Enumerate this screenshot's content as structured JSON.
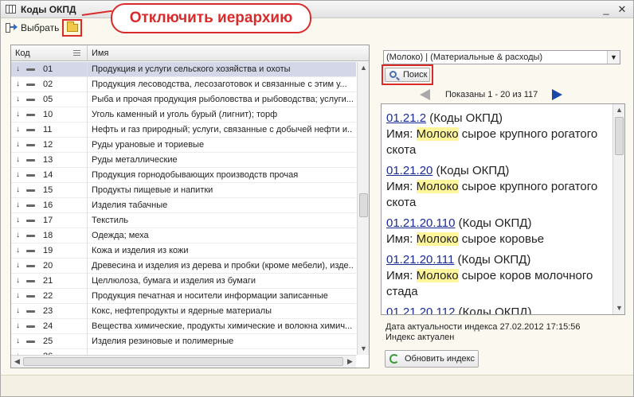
{
  "window": {
    "title": "Коды ОКПД"
  },
  "toolbar": {
    "select_label": "Выбрать"
  },
  "annotation": {
    "text": "Отключить иерархию"
  },
  "table": {
    "columns": [
      "Код",
      "Имя"
    ],
    "rows": [
      {
        "code": "01",
        "name": "Продукция и услуги сельского хозяйства и охоты"
      },
      {
        "code": "02",
        "name": "Продукция лесоводства, лесозаготовок и связанные с этим у..."
      },
      {
        "code": "05",
        "name": "Рыба и прочая продукция рыболовства и рыбоводства; услуги..."
      },
      {
        "code": "10",
        "name": "Уголь каменный и уголь бурый (лигнит); торф"
      },
      {
        "code": "11",
        "name": "Нефть и газ природный; услуги, связанные с добычей нефти и..."
      },
      {
        "code": "12",
        "name": "Руды урановые и ториевые"
      },
      {
        "code": "13",
        "name": "Руды металлические"
      },
      {
        "code": "14",
        "name": "Продукция горнодобывающих производств прочая"
      },
      {
        "code": "15",
        "name": "Продукты пищевые и напитки"
      },
      {
        "code": "16",
        "name": "Изделия табачные"
      },
      {
        "code": "17",
        "name": "Текстиль"
      },
      {
        "code": "18",
        "name": "Одежда; меха"
      },
      {
        "code": "19",
        "name": "Кожа и изделия из кожи"
      },
      {
        "code": "20",
        "name": "Древесина и изделия из дерева и пробки (кроме мебели), изде..."
      },
      {
        "code": "21",
        "name": "Целлюлоза, бумага и изделия из бумаги"
      },
      {
        "code": "22",
        "name": "Продукция печатная и носители информации записанные"
      },
      {
        "code": "23",
        "name": "Кокс, нефтепродукты и ядерные материалы"
      },
      {
        "code": "24",
        "name": "Вещества химические, продукты химические и волокна химич..."
      },
      {
        "code": "25",
        "name": "Изделия резиновые и полимерные"
      },
      {
        "code": "26",
        "name": ""
      }
    ]
  },
  "search": {
    "query": "(Молоко) | (Материальные & расходы)",
    "button_label": "Поиск",
    "pager_text": "Показаны 1 - 20 из 117"
  },
  "results": [
    {
      "code": "01.21.2",
      "type": " (Коды ОКПД)",
      "prefix": "Имя: ",
      "hl": "Молоко",
      "rest": " сырое крупного рогатого скота"
    },
    {
      "code": "01.21.20",
      "type": " (Коды ОКПД)",
      "prefix": "Имя: ",
      "hl": "Молоко",
      "rest": " сырое крупного рогатого скота"
    },
    {
      "code": "01.21.20.110",
      "type": " (Коды ОКПД)",
      "prefix": "Имя: ",
      "hl": "Молоко",
      "rest": " сырое коровье"
    },
    {
      "code": "01.21.20.111",
      "type": " (Коды ОКПД)",
      "prefix": "Имя: ",
      "hl": "Молоко",
      "rest": " сырое коров молочного стада"
    },
    {
      "code": "01.21.20.112",
      "type": " (Коды ОКПД)",
      "prefix": "",
      "hl": "",
      "rest": ""
    }
  ],
  "index": {
    "date_text": "Дата актуальности индекса 27.02.2012 17:15:56",
    "status_text": "Индекс актуален",
    "refresh_label": "Обновить индекс"
  }
}
